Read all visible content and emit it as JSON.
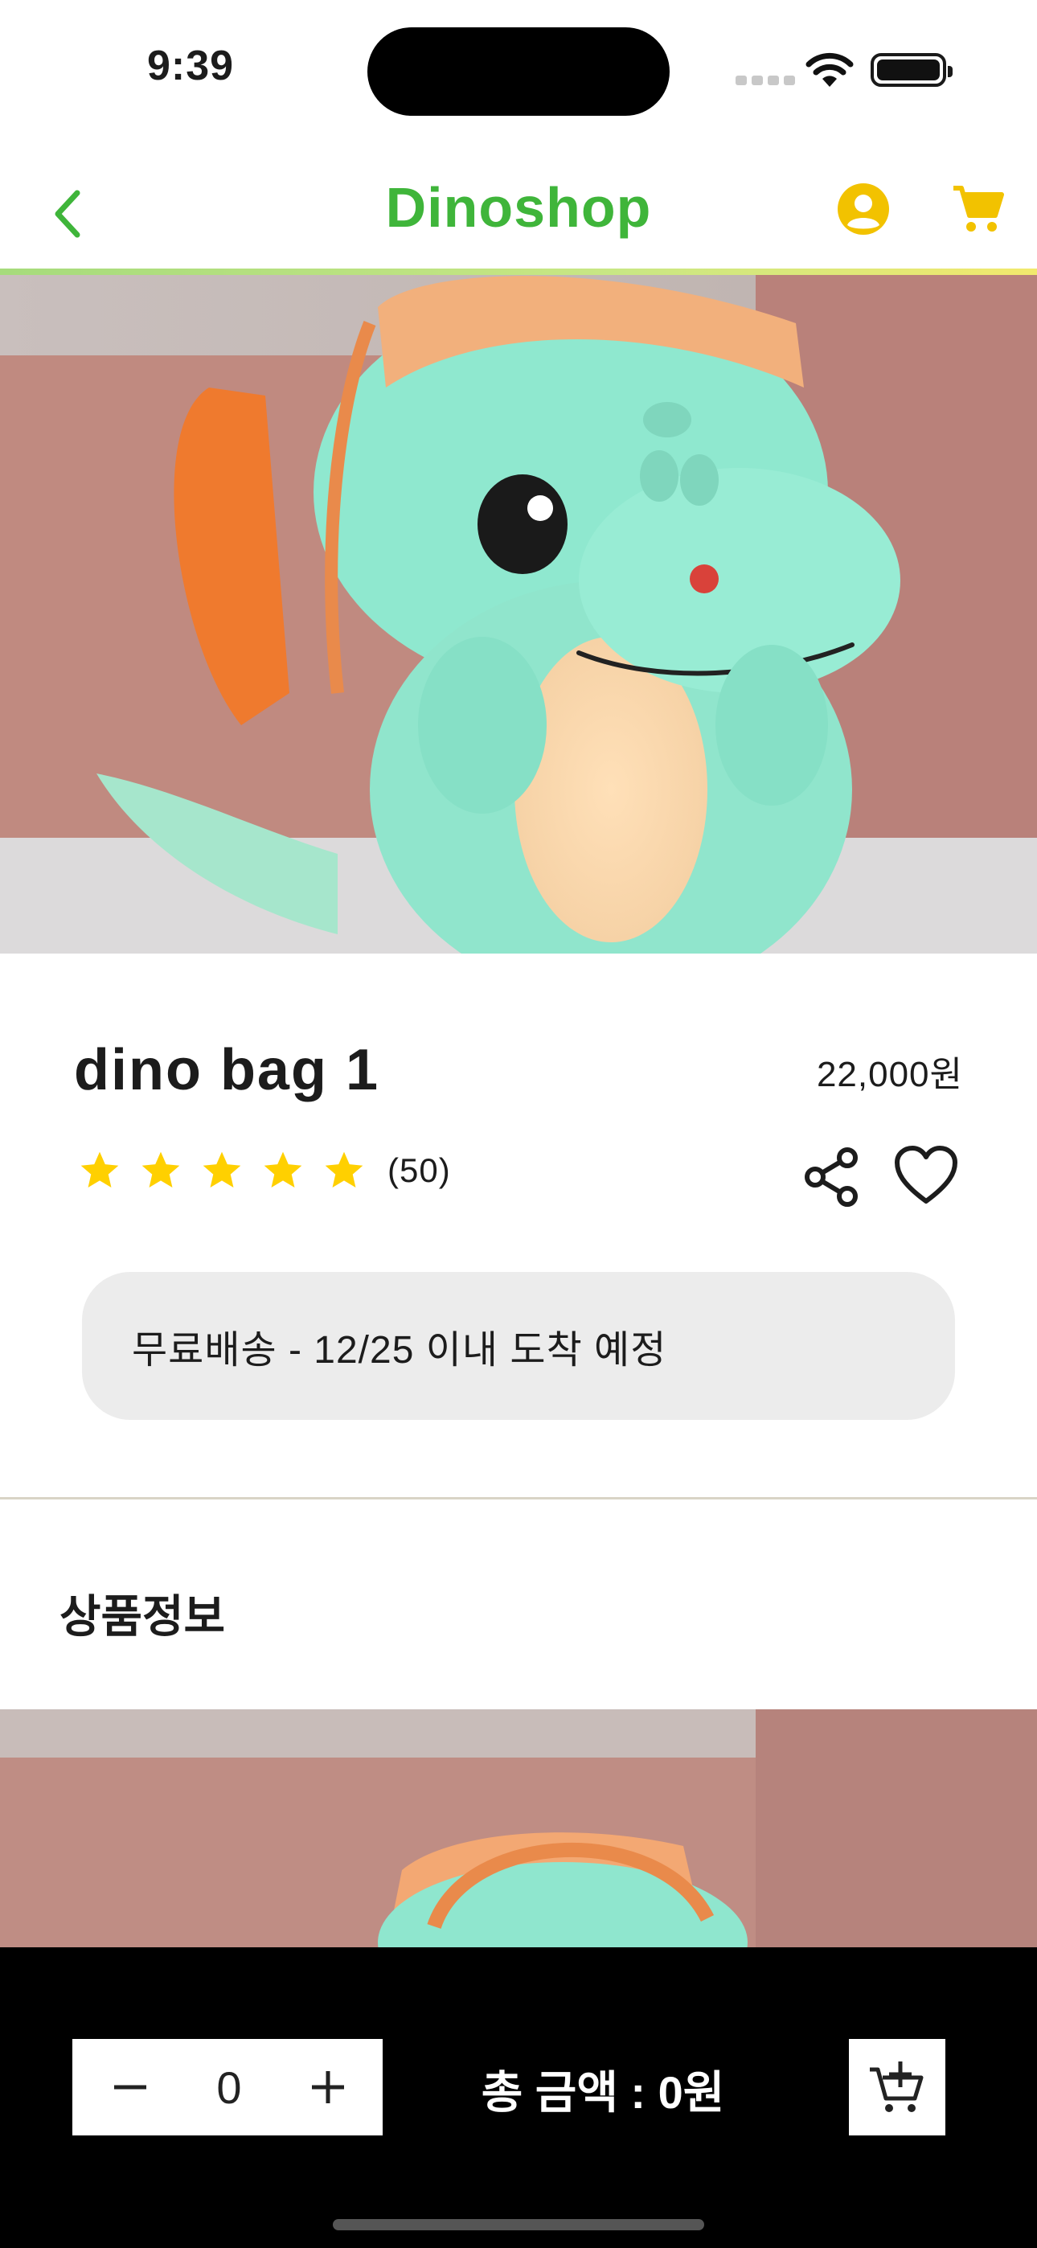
{
  "status_bar": {
    "time": "9:39"
  },
  "header": {
    "brand": "Dinoshop",
    "brand_color": "#3fb53a",
    "icon_color": "#f2c200",
    "icons": [
      "chevron-left-icon",
      "account-icon",
      "cart-icon"
    ]
  },
  "product": {
    "name": "dino bag 1",
    "price": "22,000원",
    "rating_stars": 5,
    "review_count": "(50)",
    "star_color": "#ffd000",
    "shipping_text": "무료배송  -  12/25 이내 도착 예정"
  },
  "section": {
    "title": "상품정보"
  },
  "bottom_bar": {
    "quantity": "0",
    "total": "총 금액 : 0원"
  }
}
